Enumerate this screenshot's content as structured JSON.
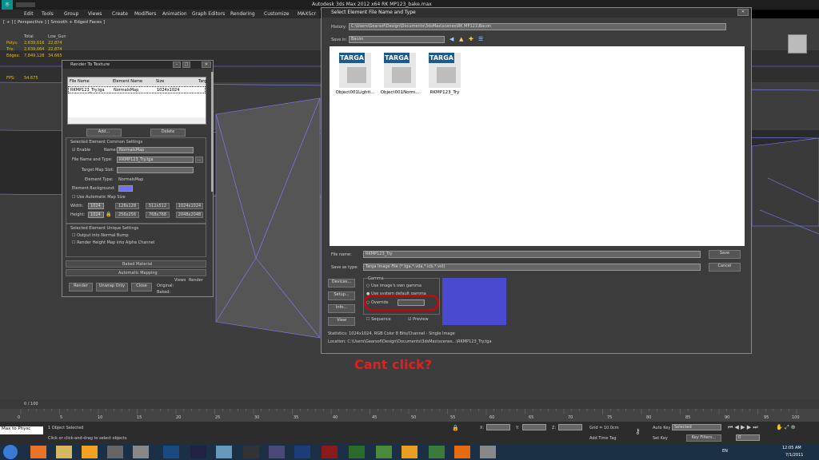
{
  "window": {
    "title": "Autodesk 3ds Max  2012 x64     RK MP123_bake.max"
  },
  "menu": [
    "Edit",
    "Tools",
    "Group",
    "Views",
    "Create",
    "Modifiers",
    "Animation",
    "Graph Editors",
    "Rendering",
    "Customize",
    "MAXScr"
  ],
  "viewport": {
    "label": "[ + ] [ Perspective ] [ Smooth + Edged Faces ]",
    "stats": {
      "headers": [
        "Total",
        "Low_Gun"
      ],
      "rows": [
        {
          "name": "Polys:",
          "total": "2,639,016",
          "low": "22,874"
        },
        {
          "name": "Tris:",
          "total": "2,639,064",
          "low": "22,874"
        },
        {
          "name": "Edges:",
          "total": "7,849,128",
          "low": "34,665"
        }
      ],
      "fps_label": "FPS:",
      "fps": "54.675"
    }
  },
  "rtt": {
    "title": "Render To Texture",
    "columns": [
      "File Name",
      "Element Name",
      "Size",
      "Targ"
    ],
    "row": {
      "file": "RKMP123_Try.tga",
      "element": "NormalsMap",
      "size": "1024x1024"
    },
    "add": "Add...",
    "delete": "Delete",
    "common_title": "Selected Element Common Settings",
    "enable": "Enable",
    "name_label": "Name:",
    "name_value": "NormalsMap",
    "file_label": "File Name and Type:",
    "file_value": "RKMP123_Try.tga",
    "target_slot": "Target Map Slot:",
    "element_type_label": "Element Type:",
    "element_type_value": "NormalsMap",
    "element_bg": "Element Background:",
    "auto_size": "Use Automatic Map Size",
    "width_label": "Width:",
    "width": "1024",
    "height_label": "Height:",
    "height": "1024",
    "sizes": [
      "128x128",
      "512x512",
      "1024x1024",
      "256x256",
      "768x768",
      "2048x2048"
    ],
    "unique_title": "Selected Element Unique Settings",
    "opt1": "Output into Normal Bump",
    "opt2": "Render Height Map into Alpha Channel",
    "baked_material": "Baked Material",
    "auto_mapping": "Automatic Mapping",
    "render": "Render",
    "unwrap": "Unwrap Only",
    "close": "Close",
    "views_label": "Views",
    "render_label": "Render",
    "original_label": "Original:",
    "baked_label": "Baked:"
  },
  "dialog": {
    "title": "Select Element File Name and Type",
    "history_label": "History:",
    "history_value": "C:\\Users\\Gearsof\\Design\\Documents\\3dsMax\\scenes\\RK MP121\\Bacon",
    "savein_label": "Save in:",
    "savein_value": "Bacon",
    "files": [
      {
        "badge": "TARGA",
        "name": "Object001Lighti..."
      },
      {
        "badge": "TARGA",
        "name": "Object001Norm..."
      },
      {
        "badge": "TARGA",
        "name": "RKMP123_Try"
      }
    ],
    "filename_label": "File name:",
    "filename_value": "RKMP123_Try",
    "saveas_label": "Save as type:",
    "saveas_value": "Targa Image File (*.tga,*.vda,*.icb,*.vst)",
    "save": "Save",
    "cancel": "Cancel",
    "devices": "Devices...",
    "setup": "Setup...",
    "info": "Info...",
    "view": "View",
    "gamma_title": "Gamma",
    "gamma_own": "Use image's own gamma",
    "gamma_system": "Use system default gamma",
    "gamma_override": "Override",
    "sequence": "Sequence",
    "preview": "Preview",
    "stats": "Statistics: 1024x1024, RGB Color 8 Bits/Channel - Single Image",
    "location": "Location: C:\\Users\\Gearsof\\Design\\Documents\\3dsMax\\scenes...\\RKMP123_Try.tga"
  },
  "annotation": "Cant click?",
  "timeline": {
    "frame": "0 / 100",
    "ticks": [
      "0",
      "5",
      "10",
      "15",
      "20",
      "25",
      "30",
      "35",
      "40",
      "45",
      "50",
      "55",
      "60",
      "65",
      "70",
      "75",
      "80",
      "85",
      "90",
      "95",
      "100"
    ]
  },
  "status": {
    "script": "Max to Physc",
    "selected": "1 Object Selected",
    "hint": "Click or click-and-drag to select objects",
    "x_label": "X:",
    "y_label": "Y:",
    "z_label": "Z:",
    "grid": "Grid = 10.0cm",
    "add_time_tag": "Add Time Tag",
    "auto_key": "Auto Key",
    "set_key": "Set Key",
    "selected_dd": "Selected",
    "key_filters": "Key Filters...",
    "frame_field": "0"
  },
  "taskbar": {
    "lang": "EN",
    "time": "12:05 AM",
    "date": "7/1/2011"
  }
}
